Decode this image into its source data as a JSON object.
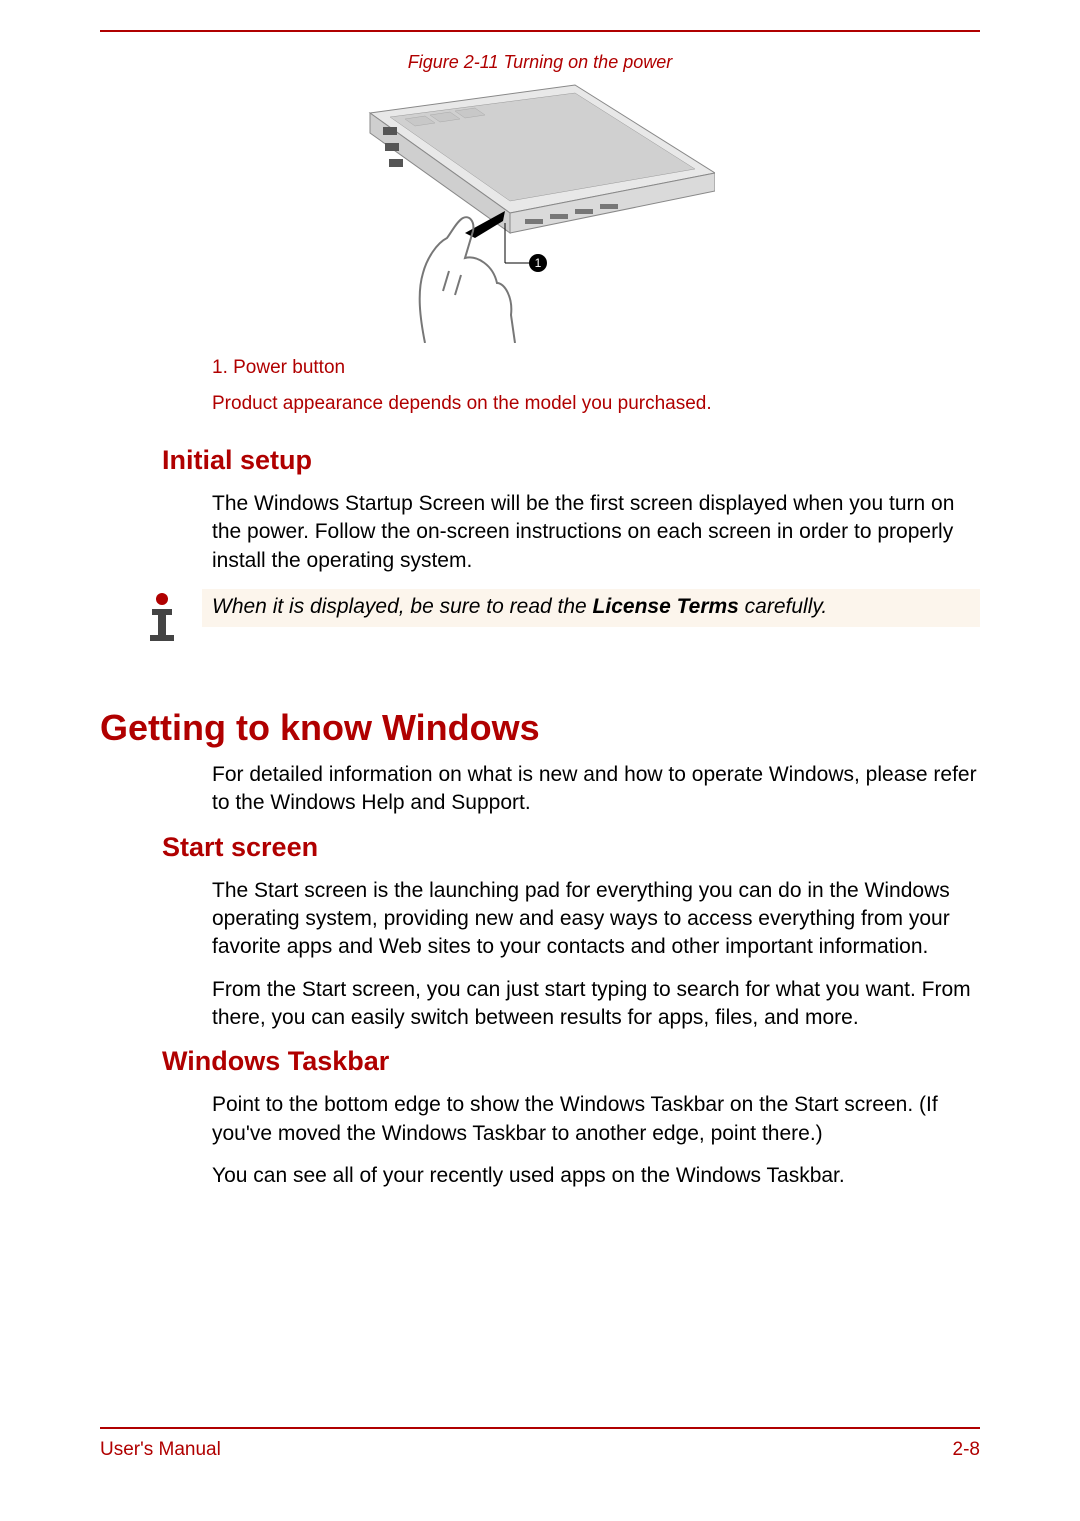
{
  "figure": {
    "caption": "Figure 2-11 Turning on the power",
    "legend": "1. Power button",
    "disclaimer": "Product appearance depends on the model you purchased."
  },
  "sections": {
    "initial_setup": {
      "heading": "Initial setup",
      "p1": "The Windows Startup Screen will be the first screen displayed when you turn on the power. Follow the on-screen instructions on each screen in order to properly install the operating system."
    },
    "note": {
      "pre": "When it is displayed, be sure to read the ",
      "bold": "License Terms",
      "post": " carefully."
    },
    "getting_to_know": {
      "heading": "Getting to know Windows",
      "p1": "For detailed information on what is new and how to operate Windows, please refer to the Windows Help and Support."
    },
    "start_screen": {
      "heading": "Start screen",
      "p1": "The Start screen is the launching pad for everything you can do in the Windows operating system, providing new and easy ways to access everything from your favorite apps and Web sites to your contacts and other important information.",
      "p2": "From the Start screen, you can just start typing to search for what you want. From there, you can easily switch between results for apps, files, and more."
    },
    "windows_taskbar": {
      "heading": "Windows Taskbar",
      "p1": "Point to the bottom edge to show the Windows Taskbar on the Start screen. (If you've moved the Windows Taskbar to another edge, point there.)",
      "p2": "You can see all of your recently used apps on the Windows Taskbar."
    }
  },
  "footer": {
    "left": "User's Manual",
    "right": "2-8"
  }
}
